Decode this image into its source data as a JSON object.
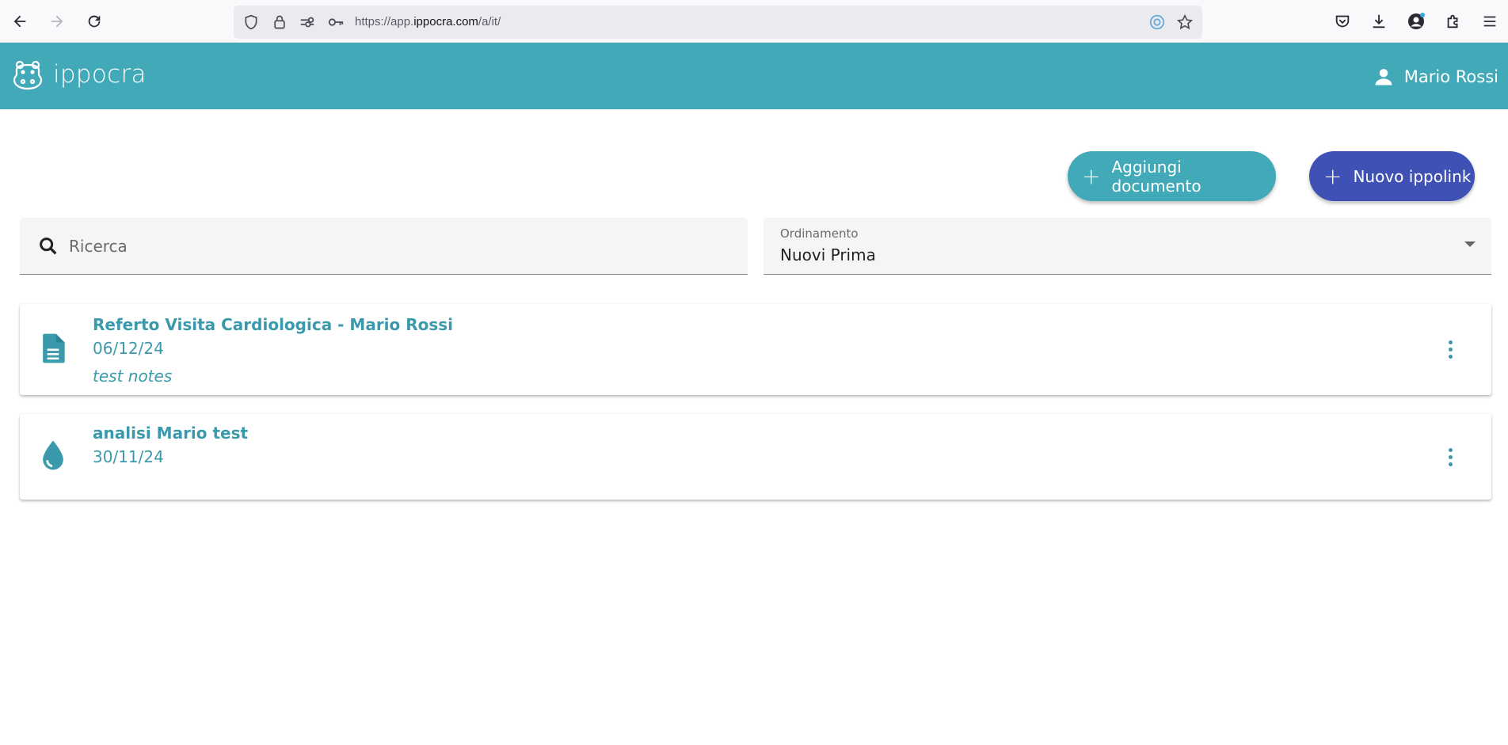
{
  "browser": {
    "url_prefix": "https://app.",
    "url_domain": "ippocra.com",
    "url_path": "/a/it/"
  },
  "header": {
    "app_name": "ippocra",
    "user_name": "Mario Rossi"
  },
  "actions": {
    "add_document_label": "Aggiungi documento",
    "new_ippolink_label": "Nuovo ippolink",
    "add_document_color": "#41a9b8",
    "new_ippolink_color": "#3f51b5"
  },
  "search": {
    "placeholder": "Ricerca",
    "value": ""
  },
  "sort": {
    "label": "Ordinamento",
    "selected": "Nuovi Prima"
  },
  "documents": [
    {
      "title": "Referto Visita Cardiologica - Mario Rossi",
      "date": "06/12/24",
      "notes": "test notes",
      "icon": "document-icon"
    },
    {
      "title": "analisi Mario test",
      "date": "30/11/24",
      "icon": "blood-drop-icon"
    }
  ],
  "colors": {
    "header_bg": "#41a9b8",
    "accent_text": "#3a9aab"
  }
}
